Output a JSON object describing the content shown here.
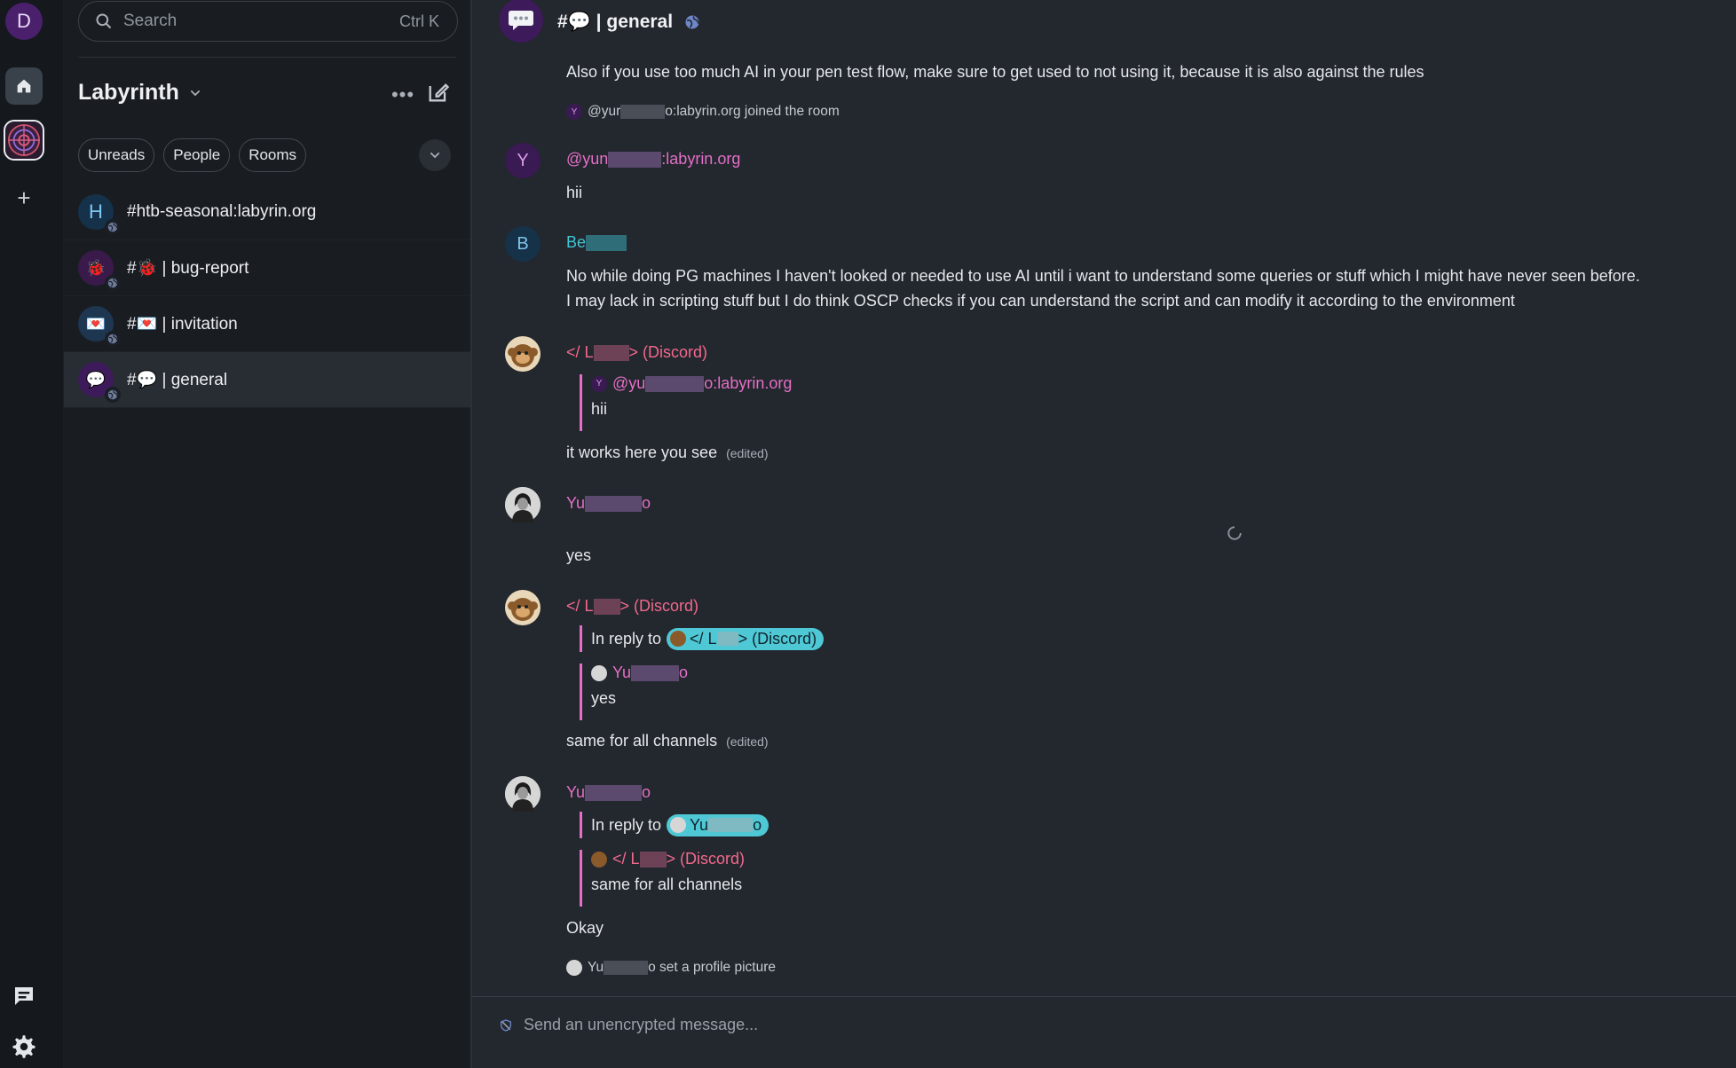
{
  "user": {
    "initial": "D"
  },
  "space": {
    "name": "Labyrinth"
  },
  "search": {
    "placeholder": "Search",
    "shortcut": "Ctrl K"
  },
  "filters": [
    "Unreads",
    "People",
    "Rooms"
  ],
  "rooms": [
    {
      "name": "#htb-seasonal:labyrin.org",
      "avatar": "H",
      "active": false
    },
    {
      "name": "#🐞 | bug-report",
      "avatar": "🐞",
      "active": false
    },
    {
      "name": "#💌 | invitation",
      "avatar": "💌",
      "active": false
    },
    {
      "name": "#💬 | general",
      "avatar": "💬",
      "active": true
    }
  ],
  "header": {
    "room_name": "#💬 | general"
  },
  "timeline": {
    "m0_text": "Also if you use too much AI in your pen test flow, make sure to get used to not using it, because it is also against the rules",
    "join_pre": "@yur",
    "join_post": "o:labyrin.org joined the room",
    "join_badge": "Y",
    "m1_avatar": "Y",
    "m1_sender_pre": "@yun",
    "m1_sender_post": ":labyrin.org",
    "m1_text": "hii",
    "m2_avatar": "B",
    "m2_sender_pre": "Be",
    "m2_text_line1": "No while doing PG machines I haven't looked or needed to use AI until i want to understand some queries or stuff which I might have never seen before.",
    "m2_text_line2": "I may lack in scripting stuff but I do think OSCP checks if you can understand the script and can modify it according to the environment",
    "m3_sender_pre": "</ L",
    "m3_sender_post": "> (Discord)",
    "m3_quote_sender_pre": "@yu",
    "m3_quote_sender_post": "o:labyrin.org",
    "m3_quote_badge": "Y",
    "m3_quote_text": "hii",
    "m3_text": "it works here you see",
    "edited_label": "(edited)",
    "m4_sender_pre": "Yu",
    "m4_sender_post": "o",
    "m4_text": "yes",
    "m5_sender_pre": "</ L",
    "m5_sender_post": "> (Discord)",
    "m5_reply_label": "In reply to",
    "m5_reply_pill_pre": "</ L",
    "m5_reply_pill_post": "> (Discord)",
    "m5_quote_sender_pre": "Yu",
    "m5_quote_sender_post": "o",
    "m5_quote_text": "yes",
    "m5_text": "same for all channels",
    "m6_sender_pre": "Yu",
    "m6_sender_post": "o",
    "m6_reply_label": "In reply to",
    "m6_reply_pill_pre": "Yu",
    "m6_reply_pill_post": "o",
    "m6_quote_sender_pre": "</ L",
    "m6_quote_sender_post": "> (Discord)",
    "m6_quote_text": "same for all channels",
    "m6_text": "Okay",
    "event_pre": "Yu",
    "event_post": "o set a profile picture"
  },
  "composer": {
    "placeholder": "Send an unencrypted message..."
  },
  "colors": {
    "accent_pink": "#e56fc7",
    "accent_teal": "#3ec6d5",
    "accent_red": "#f2698c",
    "pill_bg": "#4fc8d6"
  }
}
